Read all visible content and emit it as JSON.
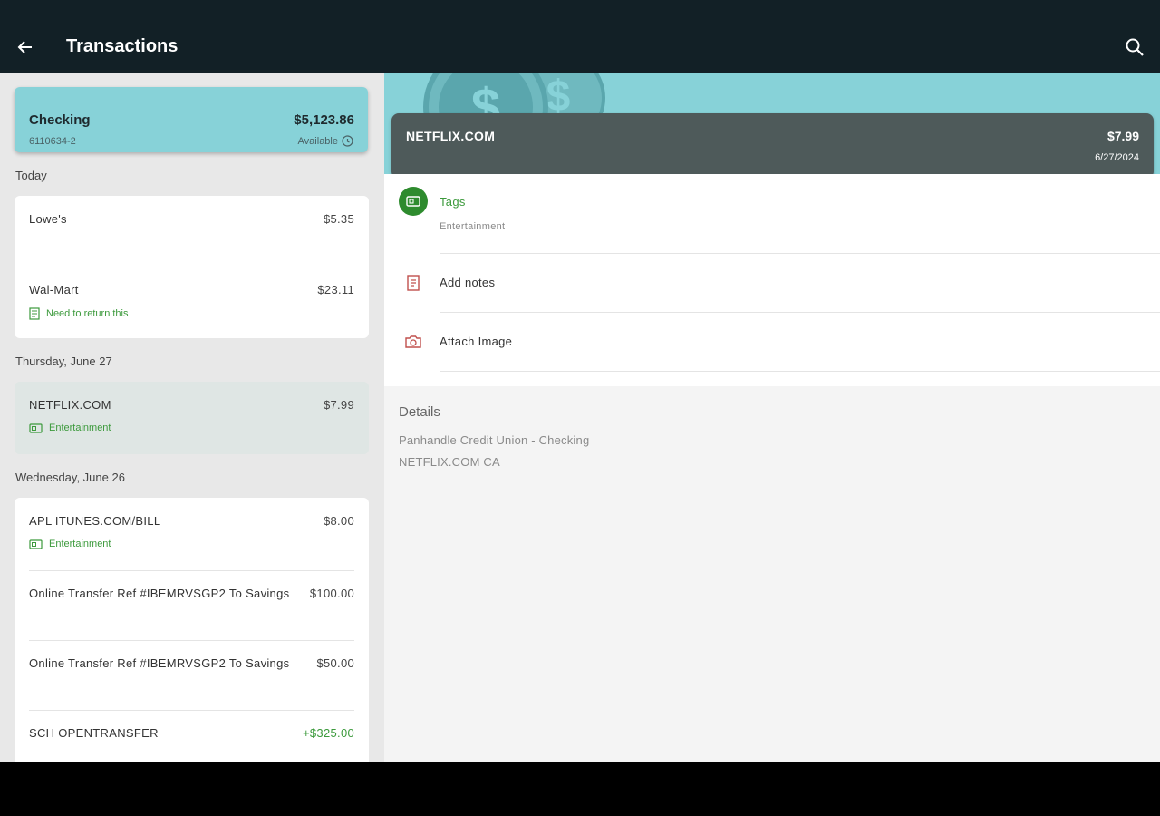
{
  "header": {
    "title": "Transactions"
  },
  "account": {
    "name": "Checking",
    "number": "6110634-2",
    "balance": "$5,123.86",
    "available_label": "Available"
  },
  "groups": [
    {
      "date": "Today",
      "items": [
        {
          "merchant": "Lowe's",
          "amount": "$5.35",
          "sub": ""
        },
        {
          "merchant": "Wal-Mart",
          "amount": "$23.11",
          "sub": "Need to return this",
          "sub_icon": "note-icon"
        }
      ]
    },
    {
      "date": "Thursday, June 27",
      "items": [
        {
          "merchant": "NETFLIX.COM",
          "amount": "$7.99",
          "sub": "Entertainment",
          "sub_icon": "tag-icon",
          "selected": true
        }
      ]
    },
    {
      "date": "Wednesday, June 26",
      "items": [
        {
          "merchant": "APL ITUNES.COM/BILL",
          "amount": "$8.00",
          "sub": "Entertainment",
          "sub_icon": "tag-icon"
        },
        {
          "merchant": "Online Transfer Ref #IBEMRVSGP2 To Savings",
          "amount": "$100.00",
          "sub": ""
        },
        {
          "merchant": "Online Transfer Ref #IBEMRVSGP2 To Savings",
          "amount": "$50.00",
          "sub": ""
        },
        {
          "merchant": "SCH OPENTRANSFER",
          "amount": "+$325.00",
          "sub": "",
          "positive": true
        }
      ]
    }
  ],
  "detail": {
    "merchant": "NETFLIX.COM",
    "amount": "$7.99",
    "date": "6/27/2024",
    "tags_label": "Tags",
    "tags_value": "Entertainment",
    "notes_label": "Add notes",
    "image_label": "Attach Image",
    "details_title": "Details",
    "details_lines": [
      "Panhandle Credit Union - Checking",
      "NETFLIX.COM CA"
    ]
  },
  "colors": {
    "topbar": "#122026",
    "accent": "#87d2d8",
    "green": "#3c9a3c",
    "red_icon": "#c0504d"
  }
}
